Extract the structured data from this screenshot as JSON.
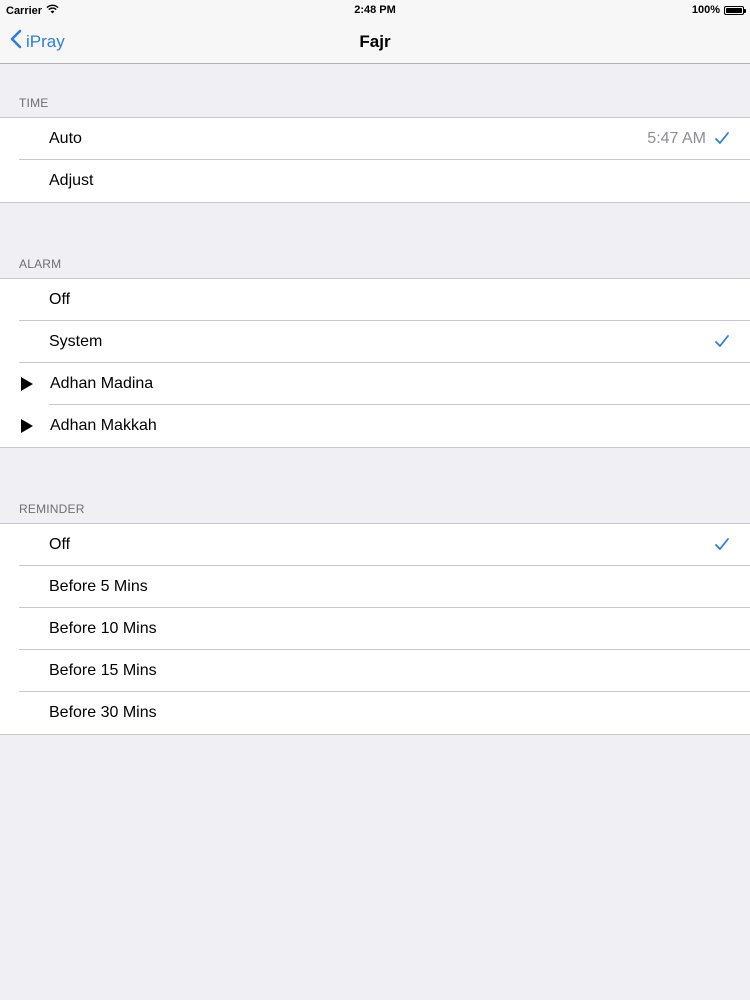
{
  "status_bar": {
    "carrier": "Carrier",
    "time": "2:48 PM",
    "battery": "100%",
    "battery_level": 1.0
  },
  "nav": {
    "back_label": "iPray",
    "title": "Fajr"
  },
  "sections": {
    "time": {
      "header": "TIME",
      "rows": [
        {
          "label": "Auto",
          "detail": "5:47 AM",
          "checked": true
        },
        {
          "label": "Adjust",
          "detail": "",
          "checked": false
        }
      ]
    },
    "alarm": {
      "header": "ALARM",
      "rows": [
        {
          "label": "Off",
          "checked": false
        },
        {
          "label": "System",
          "checked": true
        },
        {
          "label": "Adhan Madina",
          "checked": false,
          "play": true
        },
        {
          "label": "Adhan Makkah",
          "checked": false,
          "play": true
        }
      ]
    },
    "reminder": {
      "header": "REMINDER",
      "rows": [
        {
          "label": "Off",
          "checked": true
        },
        {
          "label": "Before 5 Mins",
          "checked": false
        },
        {
          "label": "Before 10 Mins",
          "checked": false
        },
        {
          "label": "Before 15 Mins",
          "checked": false
        },
        {
          "label": "Before 30 Mins",
          "checked": false
        }
      ]
    }
  },
  "colors": {
    "accent": "#2f7ed8",
    "background": "#efeff4",
    "separator": "#c8c7cc",
    "detail_text": "#8e8e93",
    "section_header_text": "#6d6d72"
  },
  "icons": {
    "back": "chevron-left-icon",
    "check": "checkmark-icon",
    "play": "play-icon",
    "wifi": "wifi-icon",
    "battery": "battery-icon"
  }
}
